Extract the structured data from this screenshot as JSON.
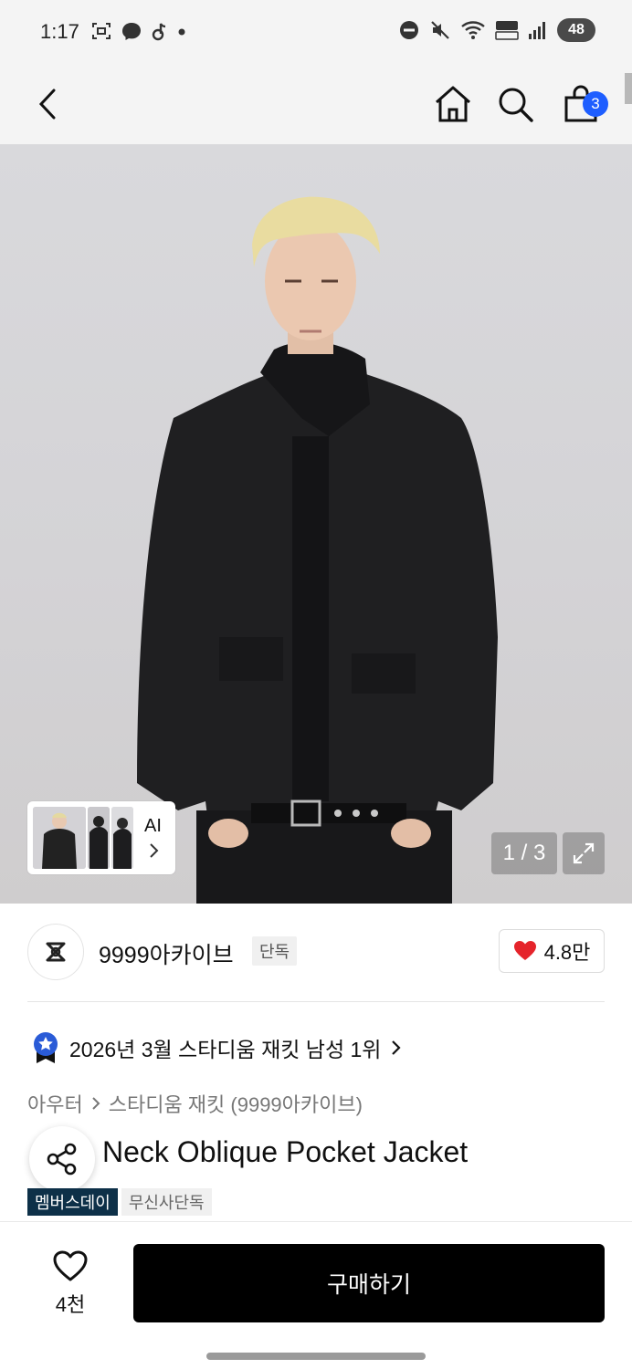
{
  "status_bar": {
    "time": "1:17",
    "battery": "48",
    "left_icons": [
      "screenshot-icon",
      "messenger-icon",
      "tiktok-icon",
      "dot-icon"
    ],
    "right_icons": [
      "dnd-icon",
      "mute-icon",
      "wifi-icon",
      "volte-icon",
      "signal-icon"
    ]
  },
  "top_nav": {
    "back_icon": "chevron-left-icon",
    "home_icon": "home-icon",
    "search_icon": "search-icon",
    "cart_icon": "shopping-bag-icon",
    "cart_count": "3"
  },
  "gallery": {
    "ai_label": "AI",
    "counter": "1 / 3"
  },
  "brand": {
    "name": "9999아카이브",
    "badge": "단독",
    "likes": "4.8만"
  },
  "ranking": {
    "text": "2026년 3월 스타디움 재킷 남성 1위"
  },
  "breadcrumb": {
    "category": "아우터",
    "subcategory": "스타디움 재킷 (9999아카이브)"
  },
  "product": {
    "title": "Neck Oblique Pocket Jacket",
    "tags": [
      "멤버스데이",
      "무신사단독"
    ]
  },
  "bottom_bar": {
    "wish_count": "4천",
    "buy_label": "구매하기"
  },
  "colors": {
    "accent_blue": "#1e5eff",
    "heart_red": "#e5242b",
    "member_tag": "#0d3048"
  }
}
